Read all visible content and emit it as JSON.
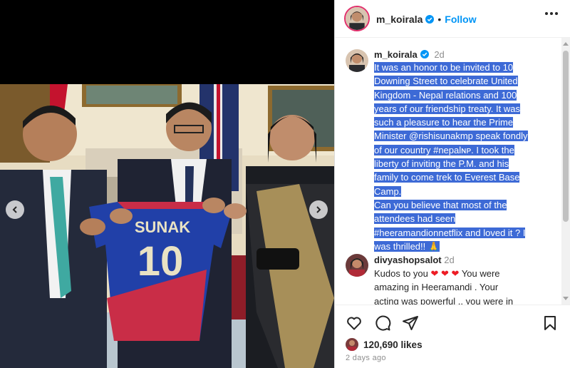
{
  "post": {
    "author": "m_koirala",
    "follow_label": "Follow",
    "separator": "•"
  },
  "photo": {
    "jersey_name": "SUNAK",
    "jersey_number": "10"
  },
  "caption": {
    "author": "m_koirala",
    "time": "2d",
    "lines": [
      "It was an honor to be invited to 10",
      "Downing Street to celebrate United",
      "Kingdom - Nepal relations and 100",
      "years of our friendship treaty. It was",
      "such a pleasure to hear the Prime",
      "Minister @rishisunakmp speak fondly",
      "of our country #nepalɴᴘ. I took the",
      "liberty of inviting the P.M. and his",
      "family to come trek to Everest Base",
      "Camp.",
      "Can you believe that most of the",
      "attendees had seen",
      "#heeramandionnetflix and loved it ? I",
      "was thrilled!! 🙏"
    ]
  },
  "comment": {
    "author": "divyashopsalot",
    "time": "2d",
    "line1_prefix": "Kudos to you",
    "hearts": "❤ ❤ ❤",
    "line1_suffix": "You were",
    "line2": "amazing in Heeramandi . Your",
    "line3": "acting was powerful .. you were in"
  },
  "engagement": {
    "likes": "120,690 likes",
    "date": "2 days ago"
  },
  "colors": {
    "accent": "#0095f6",
    "highlight": "#3d6ad6",
    "verified": "#0095f6"
  },
  "icons": [
    "heart-icon",
    "comment-icon",
    "share-icon",
    "bookmark-icon",
    "chevron-left-icon",
    "chevron-right-icon",
    "verified-badge-icon",
    "more-options-icon"
  ]
}
